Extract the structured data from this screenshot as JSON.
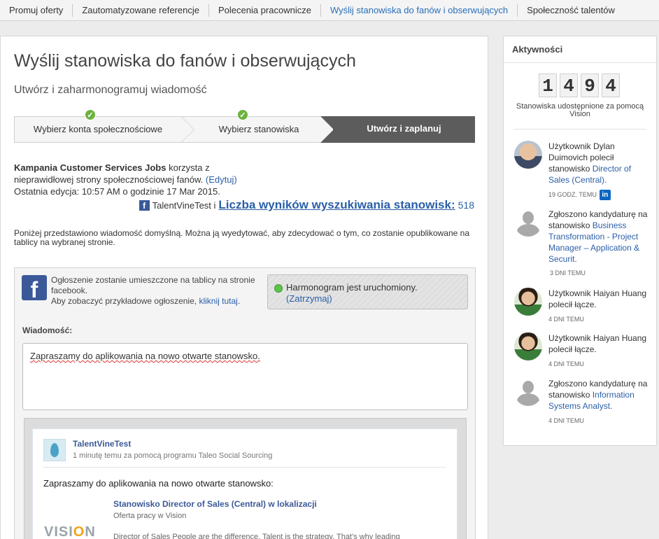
{
  "topnav": {
    "tabs": [
      {
        "label": "Promuj oferty"
      },
      {
        "label": "Zautomatyzowane referencje"
      },
      {
        "label": "Polecenia pracownicze"
      },
      {
        "label": "Wyślij stanowiska do fanów i obserwujących"
      },
      {
        "label": "Społeczność talentów"
      }
    ],
    "active_index": 3
  },
  "page": {
    "title": "Wyślij stanowiska do fanów i obserwujących",
    "subtitle": "Utwórz i zaharmonogramuj wiadomość"
  },
  "steps": [
    {
      "label": "Wybierz konta społecznościowe",
      "done": true
    },
    {
      "label": "Wybierz stanowiska",
      "done": true
    },
    {
      "label": "Utwórz i zaplanuj",
      "active": true
    }
  ],
  "campaign": {
    "name": "Kampania Customer Services Jobs",
    "text1": "korzysta z",
    "text2": "nieprawidłowej strony społecznościowej fanów.",
    "edit_link": "(Edytuj)",
    "last_edit": "Ostatnia edycja: 10:57 AM o godzinie 17 Mar 2015.",
    "account": "TalentVineTest i",
    "results_link": "Liczba wyników wyszukiwania stanowisk:",
    "results_count": "518"
  },
  "notice": "Poniżej przedstawiono wiadomość domyślną. Można ją wyedytować, aby zdecydować o tym, co zostanie opublikowane na tablicy na wybranej stronie.",
  "post_box": {
    "info1": "Ogłoszenie zostanie umieszczone na tablicy na stronie facebook.",
    "info2": "Aby zobaczyć przykładowe ogłoszenie,",
    "info_link": "kliknij tutaj",
    "info_end": ".",
    "schedule_status": "Harmonogram jest uruchomiony.",
    "schedule_link": "(Zatrzymaj)",
    "message_label": "Wiadomość:",
    "message_value": "Zapraszamy do aplikowania na nowo otwarte stanowsko."
  },
  "preview": {
    "page_name": "TalentVineTest",
    "meta": "1 minutę temu za pomocą programu Taleo Social Sourcing",
    "text": "Zapraszamy do aplikowania na nowo otwarte stanowsko:",
    "job_title": "Stanowisko Director of Sales (Central) w lokalizacji",
    "job_sub": "Oferta pracy w Vision",
    "job_desc": "Director of Sales People are the difference. Talent is the strategy. That's why leading",
    "logo_text_1": "VISI",
    "logo_text_o": "O",
    "logo_text_2": "N"
  },
  "activity": {
    "title": "Aktywności",
    "digits": [
      "1",
      "4",
      "9",
      "4"
    ],
    "caption": "Stanowiska udostępnione za pomocą Vision",
    "items": [
      {
        "text": "Użytkownik Dylan Duimovich polecił stanowisko",
        "link": "Director of Sales (Central).",
        "time": "19 GODZ. TEMU",
        "linkedin": true
      },
      {
        "text": "Zgłoszono kandydaturę na stanowisko",
        "link": "Business Transformation - Project Manager – Application & Securit.",
        "time": "3 DNI TEMU"
      },
      {
        "text": "Użytkownik Haiyan Huang polecił łącze.",
        "time": "4 DNI TEMU"
      },
      {
        "text": "Użytkownik Haiyan Huang polecił łącze.",
        "time": "4 DNI TEMU"
      },
      {
        "text": "Zgłoszono kandydaturę na stanowisko",
        "link": "Information Systems Analyst.",
        "time": "4 DNI TEMU"
      }
    ]
  }
}
